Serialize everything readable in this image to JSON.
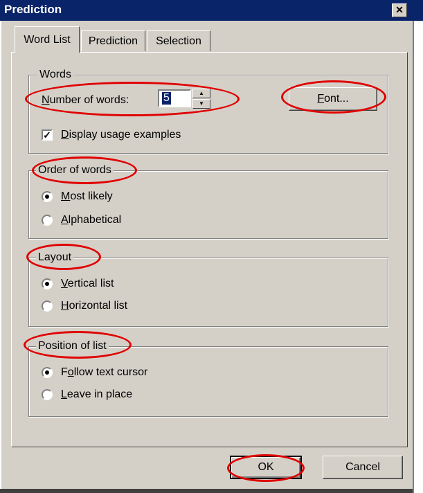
{
  "window": {
    "title": "Prediction",
    "close_glyph": "✕"
  },
  "tabs": [
    {
      "label": "Word List",
      "active": true
    },
    {
      "label": "Prediction",
      "active": false
    },
    {
      "label": "Selection",
      "active": false
    }
  ],
  "words": {
    "legend": "Words",
    "number_label_prefix": "N",
    "number_label_rest": "umber of words:",
    "number_value": "5",
    "font_button_prefix": "F",
    "font_button_rest": "ont...",
    "usage_checked": true,
    "usage_label_prefix": "D",
    "usage_label_rest": "isplay usage examples"
  },
  "order": {
    "legend": "Order of words",
    "options": [
      {
        "prefix": "M",
        "rest": "ost likely",
        "selected": true
      },
      {
        "prefix": "A",
        "rest": "lphabetical",
        "selected": false
      }
    ]
  },
  "layout": {
    "legend": "Layout",
    "options": [
      {
        "prefix": "V",
        "rest": "ertical list",
        "selected": true
      },
      {
        "prefix": "H",
        "rest": "orizontal list",
        "selected": false
      }
    ]
  },
  "position": {
    "legend": "Position of list",
    "options": [
      {
        "before": "F",
        "underline": "o",
        "rest": "llow text cursor",
        "selected": true
      },
      {
        "before": "",
        "underline": "L",
        "rest": "eave in place",
        "selected": false
      }
    ]
  },
  "buttons": {
    "ok": "OK",
    "cancel": "Cancel"
  },
  "colors": {
    "annotation": "#e00000",
    "titlebar": "#0a246a",
    "face": "#d4d0c8"
  }
}
